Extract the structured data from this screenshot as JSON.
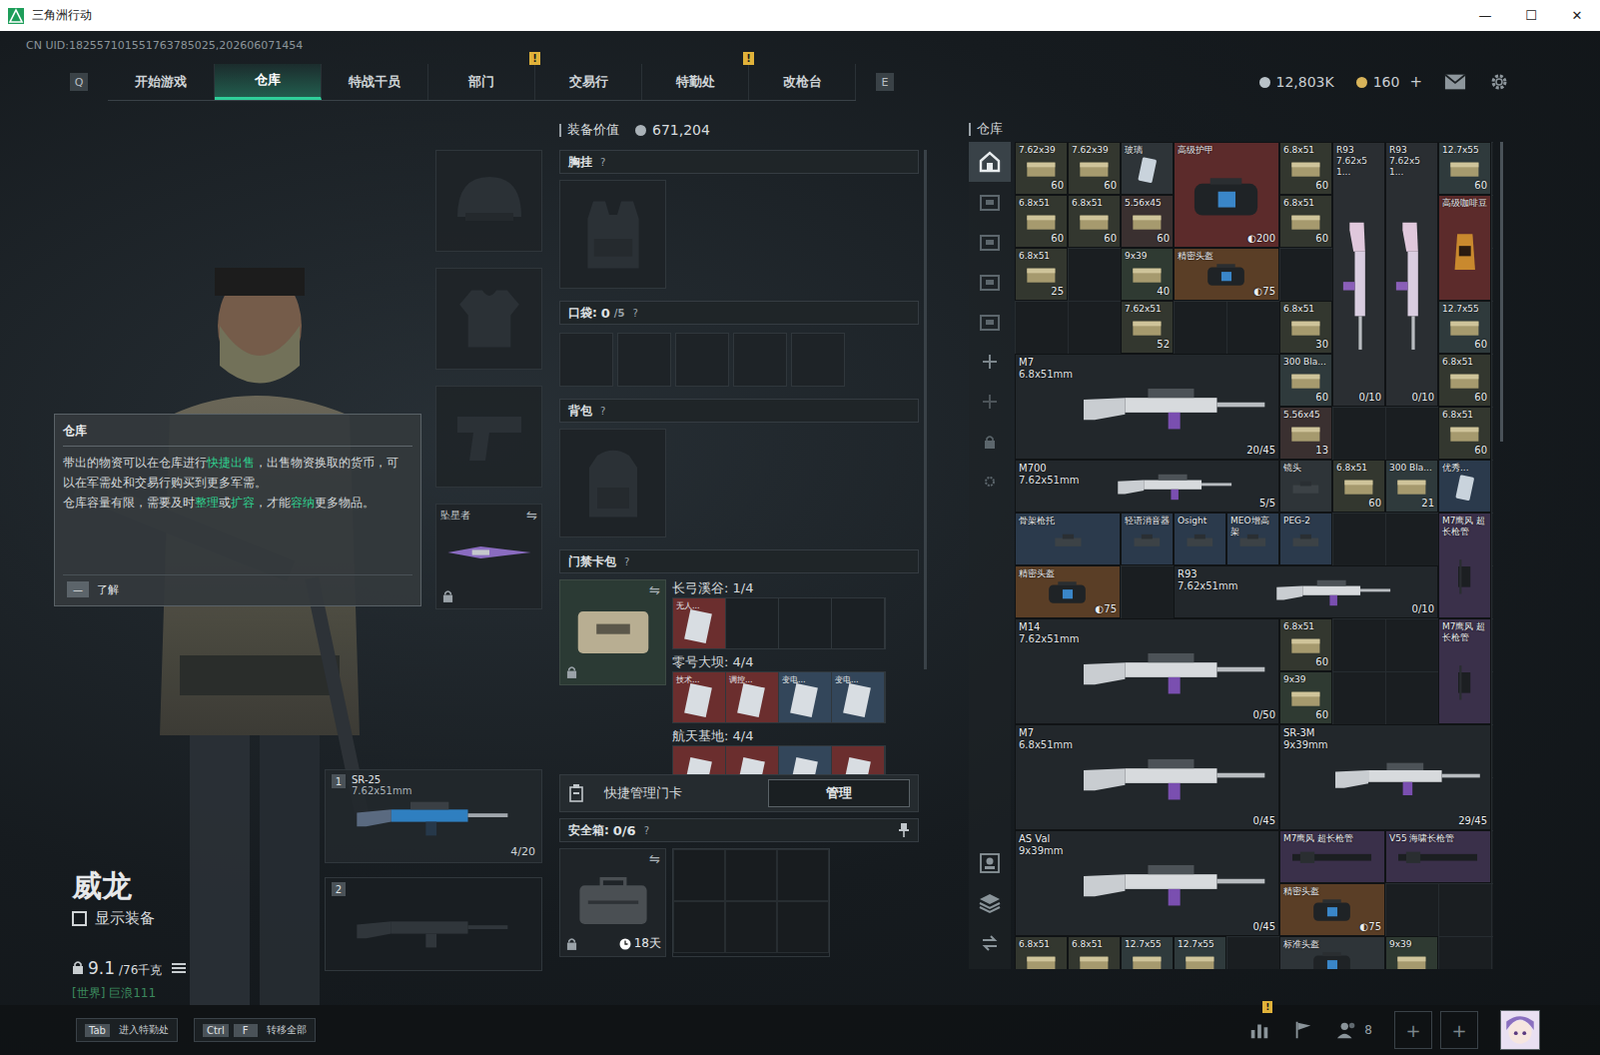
{
  "window": {
    "title": "三角洲行动",
    "controls": [
      "—",
      "☐",
      "✕"
    ]
  },
  "uid": "CN UID:182557101551763785025,202606071454",
  "nav": {
    "left_key": "Q",
    "right_key": "E",
    "tabs": [
      {
        "label": "开始游戏",
        "selected": false,
        "badge": ""
      },
      {
        "label": "仓库",
        "selected": true,
        "badge": ""
      },
      {
        "label": "特战干员",
        "selected": false,
        "badge": ""
      },
      {
        "label": "部门",
        "selected": false,
        "badge": "!"
      },
      {
        "label": "交易行",
        "selected": false,
        "badge": ""
      },
      {
        "label": "特勤处",
        "selected": false,
        "badge": "!"
      },
      {
        "label": "改枪台",
        "selected": false,
        "badge": ""
      }
    ],
    "currencies": [
      {
        "value": "12,803K",
        "color": "#b9c2c8",
        "add": ""
      },
      {
        "value": "160",
        "color": "#d8b45a",
        "add": "+"
      }
    ]
  },
  "tooltip": {
    "title": "仓库",
    "paragraphs": [
      [
        {
          "t": "带出的物资可以在仓库进行",
          "hl": false
        },
        {
          "t": "快捷出售",
          "hl": true
        },
        {
          "t": "，出售物资换取的货币，可以在军需处和交易行购买到更多军需。",
          "hl": false
        }
      ],
      [
        {
          "t": "仓库容量有限，需要及时",
          "hl": false
        },
        {
          "t": "整理",
          "hl": true
        },
        {
          "t": "或",
          "hl": false
        },
        {
          "t": "扩容",
          "hl": true
        },
        {
          "t": "，才能",
          "hl": false
        },
        {
          "t": "容纳",
          "hl": true
        },
        {
          "t": "更多物品。",
          "hl": false
        }
      ]
    ],
    "key": "—",
    "button": "了解"
  },
  "equipment": [
    {
      "kind": "helmet",
      "label": "",
      "locked": false,
      "swap": ""
    },
    {
      "kind": "armor",
      "label": "",
      "locked": false,
      "swap": ""
    },
    {
      "kind": "pistol",
      "label": "",
      "locked": false,
      "swap": ""
    },
    {
      "kind": "melee",
      "label": "坠星者",
      "locked": true,
      "swap": "⇋"
    }
  ],
  "weapons": [
    {
      "index": "1",
      "name": "SR-25",
      "caliber": "7.62x51mm",
      "ammo": "4/20",
      "empty": false
    },
    {
      "index": "2",
      "name": "",
      "caliber": "",
      "ammo": "",
      "empty": true
    }
  ],
  "operator": {
    "name": "威龙",
    "show_equipment": {
      "label": "显示装备",
      "checked": false
    },
    "weight": "9.1",
    "weight_max": "/76千克",
    "chat": "[世界] 巨浪111"
  },
  "loadout": {
    "value_label": "装备价值",
    "value": "671,204",
    "chest": {
      "label": "胸挂",
      "help": "?"
    },
    "pocket": {
      "label": "口袋:",
      "count": "0",
      "max": "/5",
      "help": "?",
      "slots": 5
    },
    "backpack": {
      "label": "背包",
      "help": "?"
    },
    "keycards": {
      "label": "门禁卡包",
      "help": "?",
      "locked": true,
      "swap": "⇋",
      "maps": [
        {
          "title": "长弓溪谷: 1/4",
          "cards": [
            {
              "label": "无人...",
              "filled": true,
              "color": "#6b2e2e"
            },
            {
              "label": "",
              "filled": false,
              "color": "#1b2024"
            },
            {
              "label": "",
              "filled": false,
              "color": "#1b2024"
            },
            {
              "label": "",
              "filled": false,
              "color": "#1b2024"
            }
          ]
        },
        {
          "title": "零号大坝: 4/4",
          "cards": [
            {
              "label": "技术...",
              "filled": true,
              "color": "#6b2e2e"
            },
            {
              "label": "调控...",
              "filled": true,
              "color": "#6b2e2e"
            },
            {
              "label": "变电...",
              "filled": true,
              "color": "#33465a"
            },
            {
              "label": "变电...",
              "filled": true,
              "color": "#33465a"
            }
          ]
        },
        {
          "title": "航天基地: 4/4",
          "cards": [
            {
              "label": "",
              "filled": true,
              "color": "#6b2e2e"
            },
            {
              "label": "",
              "filled": true,
              "color": "#6b2e2e"
            },
            {
              "label": "",
              "filled": true,
              "color": "#33465a"
            },
            {
              "label": "",
              "filled": true,
              "color": "#6b2e2e"
            }
          ]
        }
      ]
    },
    "quick_manage": {
      "label": "快捷管理门卡",
      "button": "管理"
    },
    "safe": {
      "label": "安全箱:",
      "count": "0/6",
      "help": "?",
      "timer": "18天",
      "locked": true,
      "swap": "⇋",
      "slots": 6
    }
  },
  "stash": {
    "title": "仓库",
    "sidebar": [
      {
        "kind": "home",
        "selected": true
      },
      {
        "kind": "tab",
        "selected": false
      },
      {
        "kind": "tab",
        "selected": false
      },
      {
        "kind": "tab",
        "selected": false
      },
      {
        "kind": "tab",
        "selected": false
      },
      {
        "kind": "plus",
        "selected": false
      },
      {
        "kind": "plus-dim",
        "selected": false
      },
      {
        "kind": "lock",
        "selected": false
      },
      {
        "kind": "gear",
        "selected": false
      }
    ],
    "sidebar_bottom": [
      {
        "kind": "person",
        "selected": false
      },
      {
        "kind": "layers",
        "selected": false
      },
      {
        "kind": "transfer",
        "selected": false
      }
    ],
    "items": [
      {
        "label": "7.62x39",
        "sub": "",
        "count": "60",
        "color": "#33372f",
        "kind": "ammo"
      },
      {
        "label": "7.62x39",
        "sub": "",
        "count": "60",
        "color": "#33372f",
        "kind": "ammo"
      },
      {
        "label": "玻璃",
        "sub": "",
        "count": "",
        "color": "#2e3438",
        "kind": "card"
      },
      {
        "label": "高级护甲",
        "sub": "",
        "count": "◐200",
        "color": "#5c2b2b",
        "kind": "armor"
      },
      {
        "label": "6.8x51",
        "sub": "",
        "count": "60",
        "color": "#33372f",
        "kind": "ammo"
      },
      {
        "label": "R93",
        "sub": "7.62x51...",
        "count": "0/10",
        "color": "#2a2e32",
        "kind": "rifle-v"
      },
      {
        "label": "R93",
        "sub": "7.62x51...",
        "count": "0/10",
        "color": "#2a2e32",
        "kind": "rifle-v"
      },
      {
        "label": "12.7x55",
        "sub": "",
        "count": "60",
        "color": "#2f3a3c",
        "kind": "ammo"
      },
      {
        "label": "6.8x51",
        "sub": "",
        "count": "60",
        "color": "#33372f",
        "kind": "ammo"
      },
      {
        "label": "6.8x51",
        "sub": "",
        "count": "60",
        "color": "#33372f",
        "kind": "ammo"
      },
      {
        "label": "5.56x45",
        "sub": "",
        "count": "60",
        "color": "#3a3030",
        "kind": "ammo"
      },
      {
        "label": "6.8x51",
        "sub": "",
        "count": "60",
        "color": "#33372f",
        "kind": "ammo"
      },
      {
        "label": "高级咖啡豆",
        "sub": "",
        "count": "",
        "color": "#5c2b2b",
        "kind": "coffee"
      },
      {
        "label": "6.8x51",
        "sub": "",
        "count": "25",
        "color": "#33372f",
        "kind": "ammo"
      },
      {
        "label": "9x39",
        "sub": "",
        "count": "40",
        "color": "#2f3a32",
        "kind": "ammo"
      },
      {
        "label": "精密头盔",
        "sub": "",
        "count": "◐75",
        "color": "#5a3e26",
        "kind": "helmet"
      },
      {
        "label": "7.62x51",
        "sub": "",
        "count": "52",
        "color": "#33372f",
        "kind": "ammo"
      },
      {
        "label": "6.8x51",
        "sub": "",
        "count": "30",
        "color": "#33372f",
        "kind": "ammo"
      },
      {
        "label": "12.7x55",
        "sub": "",
        "count": "60",
        "color": "#2f3a3c",
        "kind": "ammo"
      },
      {
        "label": "M7",
        "sub": "6.8x51mm",
        "count": "20/45",
        "color": "#22272b",
        "kind": "rifle"
      },
      {
        "label": "300 Bla...",
        "sub": "",
        "count": "60",
        "color": "#2f3a3c",
        "kind": "ammo"
      },
      {
        "label": "6.8x51",
        "sub": "",
        "count": "60",
        "color": "#33372f",
        "kind": "ammo"
      },
      {
        "label": "5.56x45",
        "sub": "",
        "count": "13",
        "color": "#3a3030",
        "kind": "ammo"
      },
      {
        "label": "6.8x51",
        "sub": "",
        "count": "60",
        "color": "#33372f",
        "kind": "ammo"
      },
      {
        "label": "M700",
        "sub": "7.62x51mm",
        "count": "5/5",
        "color": "#22272b",
        "kind": "rifle"
      },
      {
        "label": "镜头",
        "sub": "",
        "count": "",
        "color": "#2e3438",
        "kind": "sight"
      },
      {
        "label": "6.8x51",
        "sub": "",
        "count": "60",
        "color": "#33372f",
        "kind": "ammo"
      },
      {
        "label": "300 Bla...",
        "sub": "",
        "count": "21",
        "color": "#2f3a3c",
        "kind": "ammo"
      },
      {
        "label": "优秀...",
        "sub": "",
        "count": "",
        "color": "#2b3a4c",
        "kind": "data"
      },
      {
        "label": "骨架枪托",
        "sub": "",
        "count": "",
        "color": "#2b3a4c",
        "kind": "stock"
      },
      {
        "label": "轻语消音器",
        "sub": "",
        "count": "",
        "color": "#2b3a4c",
        "kind": "suppressor"
      },
      {
        "label": "Osight",
        "sub": "",
        "count": "",
        "color": "#2b3a4c",
        "kind": "sight"
      },
      {
        "label": "MEO增高架",
        "sub": "",
        "count": "",
        "color": "#2b3a4c",
        "kind": "mount"
      },
      {
        "label": "PEG-2",
        "sub": "",
        "count": "",
        "color": "#2b3a4c",
        "kind": "laser"
      },
      {
        "label": "M7鹰风 超长枪管",
        "sub": "",
        "count": "",
        "color": "#3a304a",
        "kind": "barrel-v"
      },
      {
        "label": "精密头盔",
        "sub": "",
        "count": "◐75",
        "color": "#5a3e26",
        "kind": "helmet"
      },
      {
        "label": "R93",
        "sub": "7.62x51mm",
        "count": "0/10",
        "color": "#22272b",
        "kind": "rifle"
      },
      {
        "label": "M14",
        "sub": "7.62x51mm",
        "count": "0/50",
        "color": "#22272b",
        "kind": "rifle"
      },
      {
        "label": "6.8x51",
        "sub": "",
        "count": "60",
        "color": "#33372f",
        "kind": "ammo"
      },
      {
        "label": "9x39",
        "sub": "",
        "count": "60",
        "color": "#2f3a32",
        "kind": "ammo"
      },
      {
        "label": "M7鹰风 超长枪管",
        "sub": "",
        "count": "",
        "color": "#3a304a",
        "kind": "barrel-v"
      },
      {
        "label": "M7",
        "sub": "6.8x51mm",
        "count": "0/45",
        "color": "#22272b",
        "kind": "rifle"
      },
      {
        "label": "SR-3M",
        "sub": "9x39mm",
        "count": "29/45",
        "color": "#22272b",
        "kind": "rifle"
      },
      {
        "label": "AS Val",
        "sub": "9x39mm",
        "count": "0/45",
        "color": "#22272b",
        "kind": "rifle"
      },
      {
        "label": "M7鹰风 超长枪管",
        "sub": "",
        "count": "",
        "color": "#3a304a",
        "kind": "barrel"
      },
      {
        "label": "V55 海啸长枪管",
        "sub": "",
        "count": "",
        "color": "#3a304a",
        "kind": "barrel"
      },
      {
        "label": "精密头盔",
        "sub": "",
        "count": "◐75",
        "color": "#5a3e26",
        "kind": "helmet"
      },
      {
        "label": "6.8x51",
        "sub": "",
        "count": "",
        "color": "#33372f",
        "kind": "ammo"
      },
      {
        "label": "6.8x51",
        "sub": "",
        "count": "",
        "color": "#33372f",
        "kind": "ammo"
      },
      {
        "label": "12.7x55",
        "sub": "",
        "count": "",
        "color": "#2f3a3c",
        "kind": "ammo"
      },
      {
        "label": "12.7x55",
        "sub": "",
        "count": "",
        "color": "#2f3a3c",
        "kind": "ammo"
      },
      {
        "label": "标准头盔",
        "sub": "",
        "count": "",
        "color": "#2e3438",
        "kind": "helmet"
      },
      {
        "label": "9x39",
        "sub": "",
        "count": "",
        "color": "#2f3a32",
        "kind": "ammo"
      }
    ]
  },
  "bottom_bar": {
    "hints": [
      {
        "keys": [
          "Tab"
        ],
        "label": "进入特勤处"
      },
      {
        "keys": [
          "Ctrl",
          "F"
        ],
        "label": "转移全部"
      }
    ],
    "stats_badge": "!",
    "friends": "8",
    "slots": [
      "+",
      "+"
    ]
  }
}
